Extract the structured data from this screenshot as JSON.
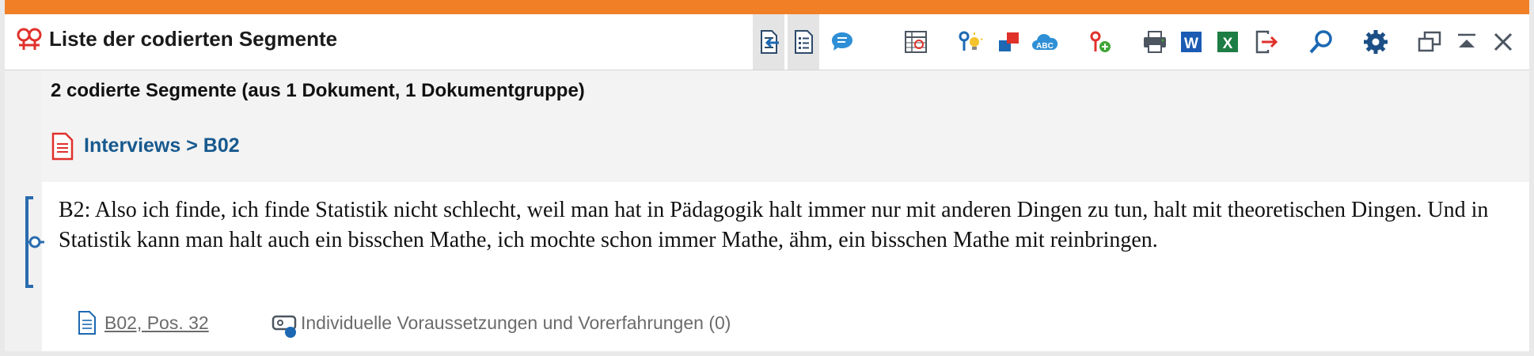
{
  "window": {
    "title": "Liste der codierten Segmente",
    "accent_color": "#f07f26"
  },
  "toolbar": {
    "icons": [
      "export-to-document-icon",
      "list-view-icon",
      "comment-bubble-icon",
      "code-matrix-icon",
      "code-idea-icon",
      "color-square-icon",
      "word-cloud-icon",
      "new-code-icon",
      "print-icon",
      "word-export-icon",
      "excel-export-icon",
      "exit-export-icon",
      "search-icon",
      "settings-icon",
      "undock-window-icon",
      "collapse-icon",
      "close-icon"
    ],
    "word_letter": "W",
    "excel_letter": "X",
    "cloud_letters": "ABC"
  },
  "summary": "2 codierte Segmente (aus 1 Dokument, 1 Dokumentgruppe)",
  "document": {
    "path": "Interviews > B02",
    "link_color": "#17598e"
  },
  "segment": {
    "text": "B2: Also ich finde, ich finde Statistik nicht schlecht, weil man hat in Pädagogik halt immer nur mit anderen Dingen zu tun, halt mit theoretischen Dingen. Und in Statistik kann man halt auch ein bisschen Mathe, ich mochte schon immer Mathe, ähm, ein bisschen Mathe mit reinbringen.",
    "source": "B02, Pos. 32",
    "code": "Individuelle Voraussetzungen und Vorerfahrungen (0)",
    "bracket_color": "#2a6cae"
  }
}
